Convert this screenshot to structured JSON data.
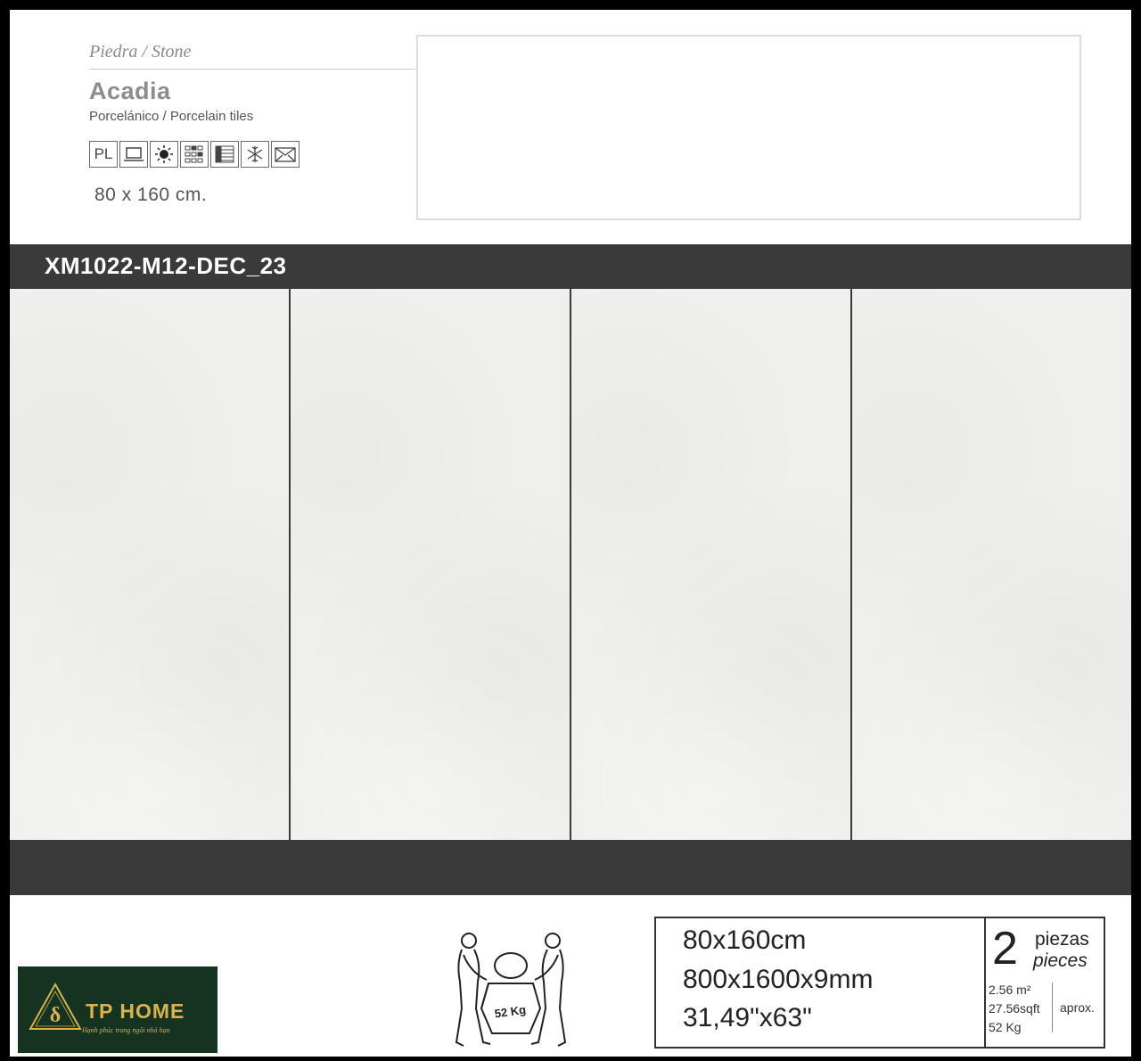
{
  "header": {
    "category": "Piedra / Stone",
    "product_name": "Acadia",
    "product_type": "Porcelánico / Porcelain tiles",
    "feature_icons": [
      {
        "name": "pl-finish-icon",
        "text": "PL"
      },
      {
        "name": "rectified-icon",
        "text": ""
      },
      {
        "name": "sun-resistance-icon",
        "text": ""
      },
      {
        "name": "shade-variation-icon",
        "text": ""
      },
      {
        "name": "face-variation-icon",
        "text": ""
      },
      {
        "name": "frost-resistant-icon",
        "text": ""
      },
      {
        "name": "envelope-icon",
        "text": ""
      }
    ],
    "size": "80 x 160 cm."
  },
  "code_band": {
    "code": "XM1022-M12-DEC_23"
  },
  "tiles": {
    "count": 4,
    "color": "#efefed"
  },
  "logo": {
    "name": "TP HOME",
    "slogan": "Hạnh phúc trong ngôi nhà bạn",
    "bg_color": "#143320",
    "accent_color": "#d9b24e"
  },
  "carry_illustration": {
    "weight_label": "52 Kg"
  },
  "specs": {
    "size_cm": "80x160cm",
    "size_mm": "800x1600x9mm",
    "size_in": "31,49\"x63\"",
    "pieces_count": "2",
    "pieces_es": "piezas",
    "pieces_en": "pieces",
    "area_m2": "2.56 m²",
    "area_sqft": "27.56sqft",
    "weight": "52 Kg",
    "approx": "aprox."
  }
}
